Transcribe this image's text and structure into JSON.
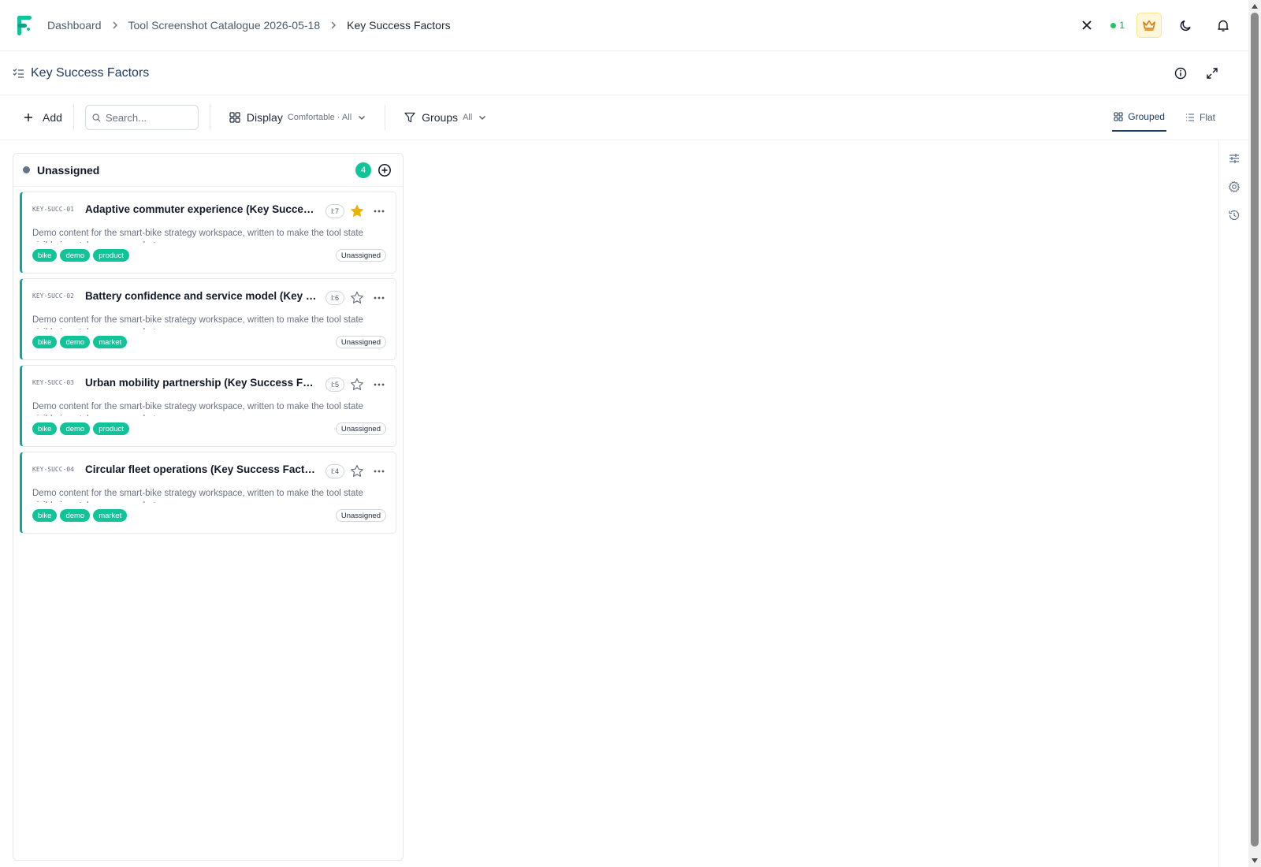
{
  "breadcrumb": [
    {
      "label": "Dashboard"
    },
    {
      "label": "Tool Screenshot Catalogue 2026-05-18"
    },
    {
      "label": "Key Success Factors"
    }
  ],
  "topbar": {
    "status_count": "1",
    "icons": [
      "close-icon",
      "crown-icon",
      "moon-icon",
      "bell-icon"
    ]
  },
  "page": {
    "title": "Key Success Factors",
    "actions": [
      "info-icon",
      "expand-icon"
    ]
  },
  "toolbar": {
    "add_label": "Add",
    "search_placeholder": "Search...",
    "display_label": "Display",
    "display_value": "Comfortable · All",
    "groups_label": "Groups",
    "groups_value": "All",
    "views": [
      {
        "label": "Grouped",
        "active": true
      },
      {
        "label": "Flat",
        "active": false
      }
    ]
  },
  "right_rail": [
    "sliders-icon",
    "gear-icon",
    "history-icon"
  ],
  "colors": {
    "accent": "#10c49a",
    "card_border": "#0ea5a0",
    "star": "#eab308",
    "title": "#1e3a5f"
  },
  "group": {
    "name": "Unassigned",
    "count": "4",
    "cards": [
      {
        "id": "KEY-SUCC-01",
        "title": "Adaptive commuter experience (Key Success Factors)",
        "badge": "I:7",
        "starred": true,
        "description": "Demo content for the smart-bike strategy workspace, written to make the tool state visible in catalogue screenshots.",
        "tags": [
          "bike",
          "demo",
          "product"
        ],
        "status": "Unassigned"
      },
      {
        "id": "KEY-SUCC-02",
        "title": "Battery confidence and service model (Key Success Factors)",
        "badge": "I:6",
        "starred": false,
        "description": "Demo content for the smart-bike strategy workspace, written to make the tool state visible in catalogue screenshots.",
        "tags": [
          "bike",
          "demo",
          "market"
        ],
        "status": "Unassigned"
      },
      {
        "id": "KEY-SUCC-03",
        "title": "Urban mobility partnership (Key Success Factors)",
        "badge": "I:5",
        "starred": false,
        "description": "Demo content for the smart-bike strategy workspace, written to make the tool state visible in catalogue screenshots.",
        "tags": [
          "bike",
          "demo",
          "product"
        ],
        "status": "Unassigned"
      },
      {
        "id": "KEY-SUCC-04",
        "title": "Circular fleet operations (Key Success Factors)",
        "badge": "I:4",
        "starred": false,
        "description": "Demo content for the smart-bike strategy workspace, written to make the tool state visible in catalogue screenshots.",
        "tags": [
          "bike",
          "demo",
          "market"
        ],
        "status": "Unassigned"
      }
    ]
  }
}
